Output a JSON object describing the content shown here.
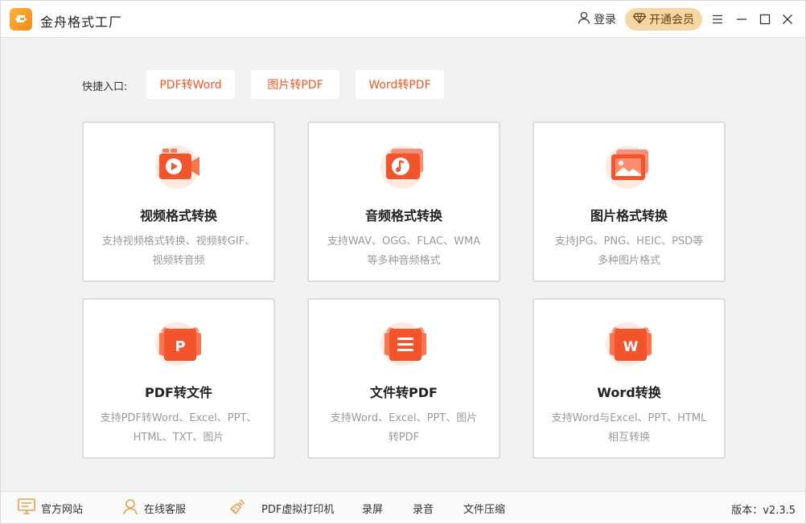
{
  "app": {
    "title": "金舟格式工厂",
    "login_label": "登录",
    "vip_label": "开通会员",
    "brand_color": "#f26b1d",
    "vip_color": "#f5d7a6"
  },
  "quick": {
    "label": "快捷入口:",
    "items": [
      "PDF转Word",
      "图片转PDF",
      "Word转PDF"
    ]
  },
  "cards": [
    {
      "title": "视频格式转换",
      "desc1": "支持视频格式转换、视频转GIF、",
      "desc2": "视频转音频",
      "icon": "video-icon"
    },
    {
      "title": "音频格式转换",
      "desc1": "支持WAV、OGG、FLAC、WMA",
      "desc2": "等多种音频格式",
      "icon": "music-icon"
    },
    {
      "title": "图片格式转换",
      "desc1": "支持JPG、PNG、HEIC、PSD等",
      "desc2": "多种图片格式",
      "icon": "image-icon"
    },
    {
      "title": "PDF转文件",
      "desc1": "支持PDF转Word、Excel、PPT、",
      "desc2": "HTML、TXT、图片",
      "icon": "ppt-file-icon"
    },
    {
      "title": "文件转PDF",
      "desc1": "支持Word、Excel、PPT、图片",
      "desc2": "转PDF",
      "icon": "document-icon"
    },
    {
      "title": "Word转换",
      "desc1": "支持Word与Excel、PPT、HTML",
      "desc2": "相互转换",
      "icon": "word-file-icon"
    }
  ],
  "footer": {
    "items": [
      "官方网站",
      "在线客服",
      "PDF虚拟打印机",
      "录屏",
      "录音",
      "文件压缩"
    ],
    "version": "版本：v2.3.5"
  }
}
